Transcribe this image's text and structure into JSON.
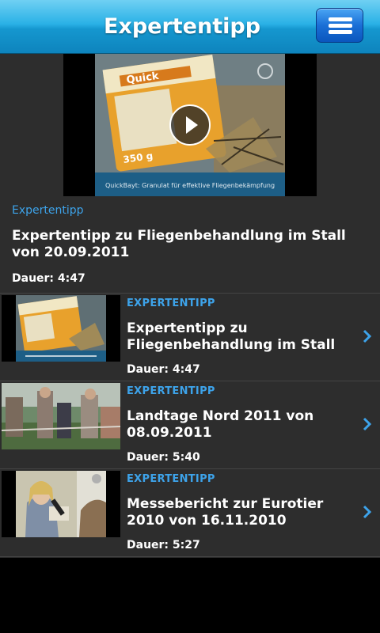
{
  "header": {
    "title": "Expertentipp",
    "menu_icon": "hamburger-menu-icon"
  },
  "featured": {
    "category": "Expertentipp",
    "title": "Expertentipp zu Fliegenbehandlung im Stall von 20.09.2011",
    "duration": "Dauer: 4:47",
    "thumbnail_caption": "QuickBayt: Granulat für effektive Fliegenbekämpfung",
    "product_brand": "Quick",
    "product_weight": "350 g"
  },
  "items": [
    {
      "category": "EXPERTENTIPP",
      "title": "Expertentipp zu Fliegenbehandlung im Stall von",
      "duration": "Dauer: 4:47"
    },
    {
      "category": "EXPERTENTIPP",
      "title": "Landtage Nord 2011 von 08.09.2011",
      "duration": "Dauer: 5:40"
    },
    {
      "category": "EXPERTENTIPP",
      "title": "Messebericht zur Eurotier 2010 von 16.11.2010",
      "duration": "Dauer: 5:27"
    }
  ],
  "colors": {
    "accent": "#3da3ea",
    "header": "#1a9fd8",
    "list_bg": "#2d2d2d"
  }
}
